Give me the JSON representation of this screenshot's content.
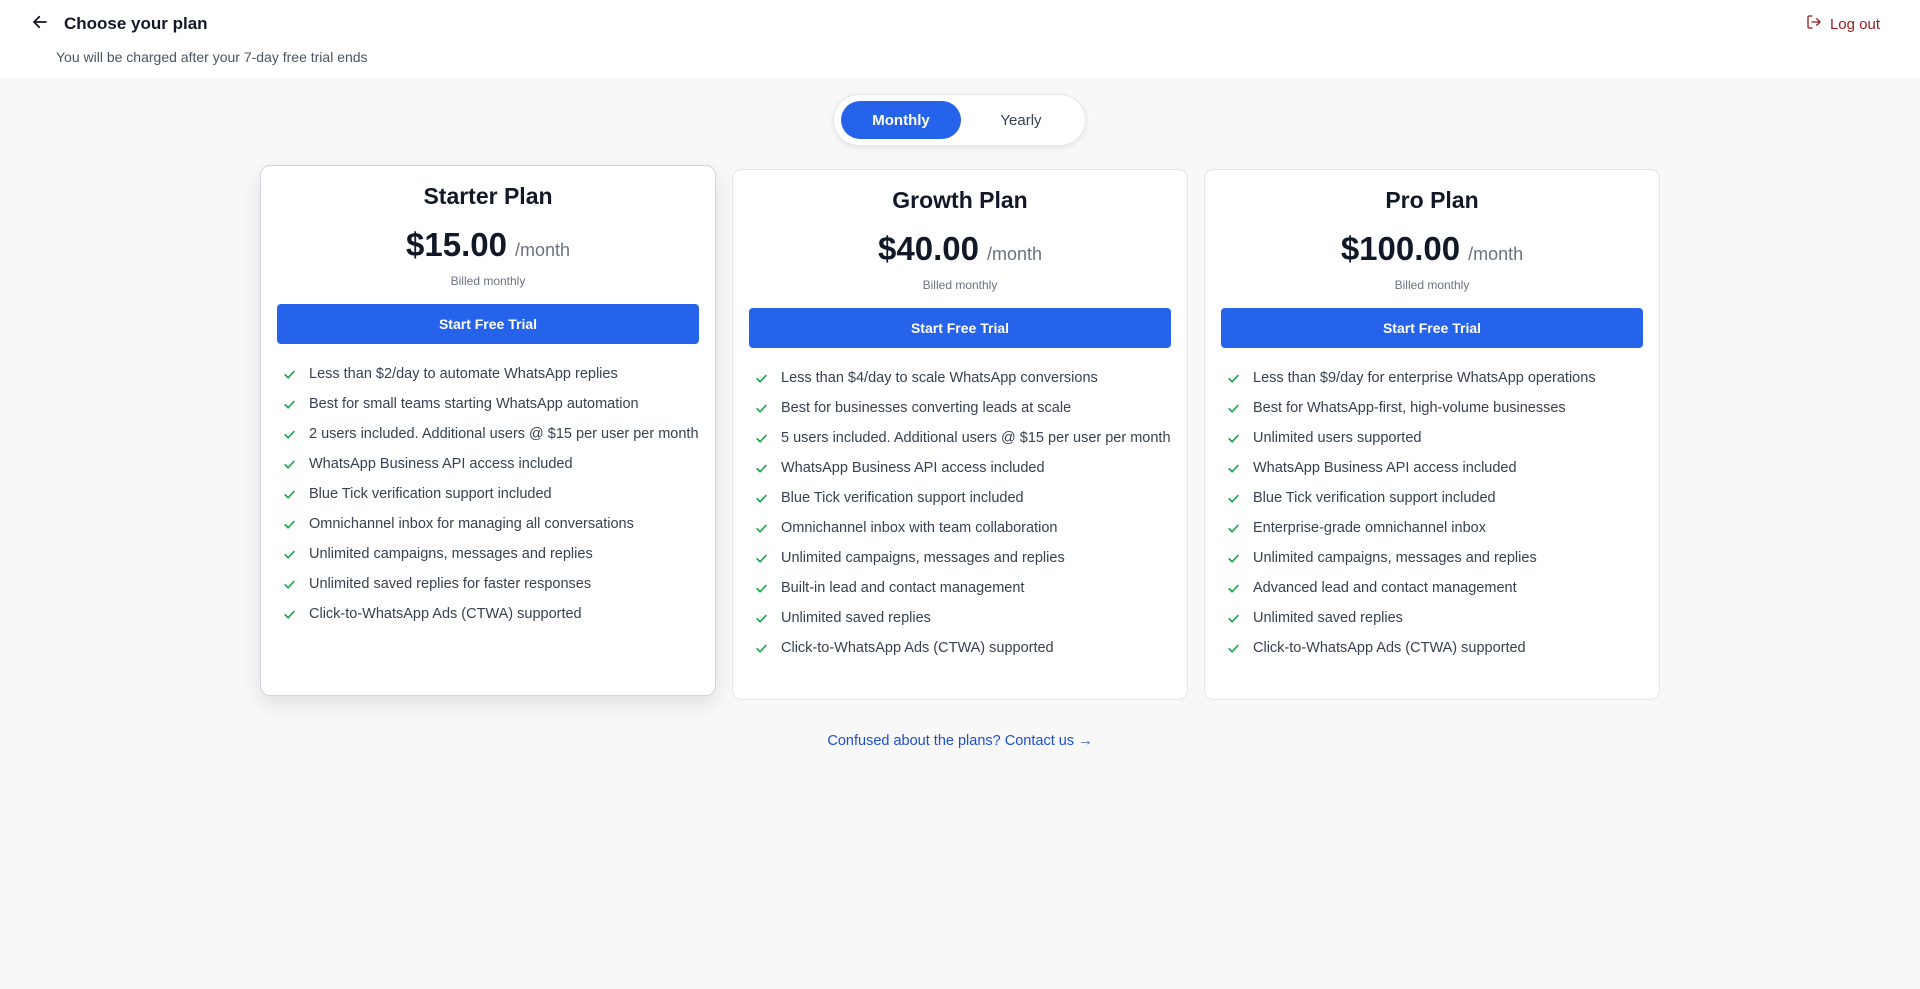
{
  "header": {
    "title": "Choose your plan",
    "subtitle": "You will be charged after your 7-day free trial ends",
    "logout_label": "Log out"
  },
  "billing_toggle": {
    "monthly_label": "Monthly",
    "yearly_label": "Yearly",
    "selected": "Monthly"
  },
  "plans": [
    {
      "name": "Starter Plan",
      "price": "$15.00",
      "period": "/month",
      "billed": "Billed monthly",
      "cta": "Start Free Trial",
      "features": [
        "Less than $2/day to automate WhatsApp replies",
        "Best for small teams starting WhatsApp automation",
        "2 users included. Additional users @ $15 per user per month",
        "WhatsApp Business API access included",
        "Blue Tick verification support included",
        "Omnichannel inbox for managing all conversations",
        "Unlimited campaigns, messages and replies",
        "Unlimited saved replies for faster responses",
        "Click-to-WhatsApp Ads (CTWA) supported"
      ]
    },
    {
      "name": "Growth Plan",
      "price": "$40.00",
      "period": "/month",
      "billed": "Billed monthly",
      "cta": "Start Free Trial",
      "features": [
        "Less than $4/day to scale WhatsApp conversions",
        "Best for businesses converting leads at scale",
        "5 users included. Additional users @ $15 per user per month",
        "WhatsApp Business API access included",
        "Blue Tick verification support included",
        "Omnichannel inbox with team collaboration",
        "Unlimited campaigns, messages and replies",
        "Built-in lead and contact management",
        "Unlimited saved replies",
        "Click-to-WhatsApp Ads (CTWA) supported"
      ]
    },
    {
      "name": "Pro Plan",
      "price": "$100.00",
      "period": "/month",
      "billed": "Billed monthly",
      "cta": "Start Free Trial",
      "features": [
        "Less than $9/day for enterprise WhatsApp operations",
        "Best for WhatsApp-first, high-volume businesses",
        "Unlimited users supported",
        "WhatsApp Business API access included",
        "Blue Tick verification support included",
        "Enterprise-grade omnichannel inbox",
        "Unlimited campaigns, messages and replies",
        "Advanced lead and contact management",
        "Unlimited saved replies",
        "Click-to-WhatsApp Ads (CTWA) supported"
      ]
    }
  ],
  "contact_link": "Confused about the plans? Contact us →",
  "icons": {
    "back": "arrow-left-icon",
    "logout": "logout-icon",
    "feature": "check-icon"
  },
  "colors": {
    "primary": "#2563eb",
    "check": "#16a34a",
    "logout": "#991b1b",
    "link": "#1d4ed8"
  }
}
